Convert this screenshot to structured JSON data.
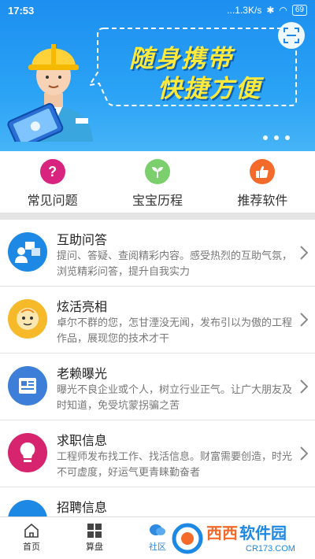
{
  "status": {
    "time": "17:53",
    "speed": "...1.3K/s",
    "battery": "69"
  },
  "banner": {
    "line1": "随身携带",
    "line2": "快捷方便",
    "page_count": 3
  },
  "quick_tabs": [
    {
      "label": "常见问题",
      "icon": "question-icon",
      "color": "#d8237f"
    },
    {
      "label": "宝宝历程",
      "icon": "sprout-icon",
      "color": "#7bcf6c"
    },
    {
      "label": "推荐软件",
      "icon": "thumbs-up-icon",
      "color": "#f36a2b"
    }
  ],
  "list": [
    {
      "title": "互助问答",
      "desc": "提问、答疑、查阅精彩内容。感受热烈的互助气氛，浏览精彩问答，提升自我实力",
      "icon": "qa-icon",
      "color": "#1e88e5"
    },
    {
      "title": "炫活亮相",
      "desc": "卓尔不群的您，怎甘湮没无闻，发布引以为傲的工程作品，展现您的技术才干",
      "icon": "face-icon",
      "color": "#f5b929"
    },
    {
      "title": "老赖曝光",
      "desc": "曝光不良企业或个人，树立行业正气。让广大朋友及时知道，免受坑蒙拐骗之苦",
      "icon": "document-icon",
      "color": "#3d7fd8"
    },
    {
      "title": "求职信息",
      "desc": "工程师发布找工作、找活信息。财富需要创造，时光不可虚度，好运气更青睐勤奋者",
      "icon": "lightbulb-icon",
      "color": "#d6246e"
    },
    {
      "title": "招聘信息",
      "desc": "",
      "icon": "briefcase-icon",
      "color": "#1e88e5"
    }
  ],
  "nav": [
    {
      "label": "首页",
      "icon": "home-icon"
    },
    {
      "label": "算盘",
      "icon": "grid-icon"
    },
    {
      "label": "社区",
      "icon": "community-icon",
      "active": true
    },
    {
      "label": "",
      "icon": ""
    },
    {
      "label": "",
      "icon": ""
    }
  ],
  "watermark": {
    "brand": "西西软件园",
    "url": "CR173.COM"
  }
}
